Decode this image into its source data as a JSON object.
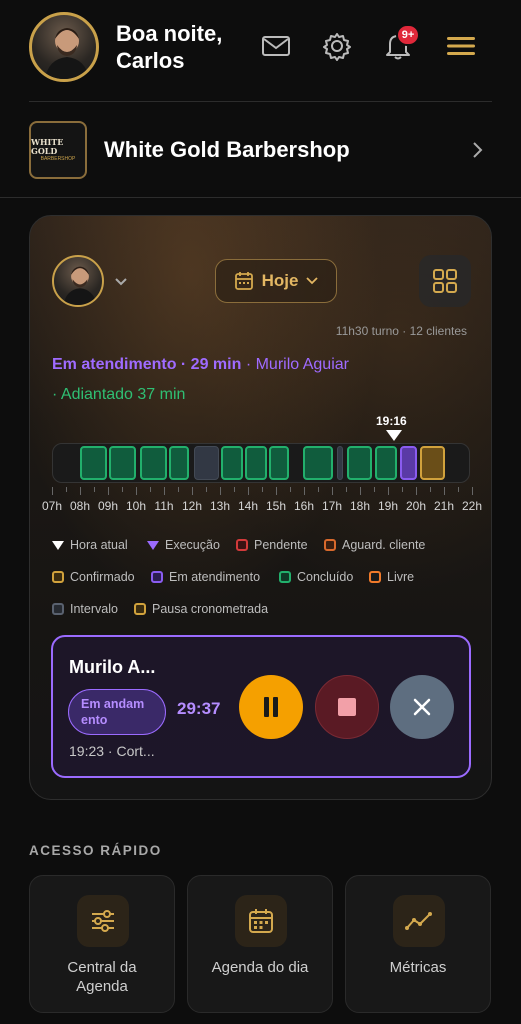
{
  "header": {
    "greeting": "Boa noite,",
    "user_name": "Carlos",
    "notification_badge": "9+"
  },
  "shop": {
    "logo_text_top": "WHITE GOLD",
    "logo_text_bottom": "BARBERSHOP",
    "name": "White Gold Barbershop"
  },
  "schedule": {
    "date_label": "Hoje",
    "turno": "11h30 turno · 12 clientes",
    "status_label": "Em atendimento · 29 min",
    "status_client": " · Murilo Aguiar",
    "status_ahead": "· Adiantado 37 min",
    "current_time": "19:16",
    "hours": [
      "07h",
      "08h",
      "09h",
      "10h",
      "11h",
      "12h",
      "13h",
      "14h",
      "15h",
      "16h",
      "17h",
      "18h",
      "19h",
      "20h",
      "21h",
      "22h"
    ],
    "legend": {
      "hora_atual": "Hora atual",
      "execucao": "Execução",
      "pendente": "Pendente",
      "aguard": "Aguard. cliente",
      "confirmado": "Confirmado",
      "em_atendimento": "Em atendimento",
      "concluido": "Concluído",
      "livre": "Livre",
      "intervalo": "Intervalo",
      "pausa": "Pausa cronometrada"
    },
    "colors": {
      "concluido": "#22b06c",
      "em_atendimento": "#8a5cf0",
      "confirmado": "#d1a23c",
      "pendente": "#d23a3a",
      "aguard": "#d8692c",
      "livre": "#f07a2a",
      "intervalo": "#59616f",
      "pausa": "#d1a23c"
    }
  },
  "current_appointment": {
    "client": "Murilo A...",
    "status": "Em andam ento",
    "timer": "29:37",
    "details": "19:23 · Cort..."
  },
  "quick_access": {
    "title": "ACESSO RÁPIDO",
    "items": [
      {
        "label": "Central da Agenda",
        "icon": "sliders-icon"
      },
      {
        "label": "Agenda do dia",
        "icon": "calendar-icon"
      },
      {
        "label": "Métricas",
        "icon": "chart-line-icon"
      }
    ]
  }
}
